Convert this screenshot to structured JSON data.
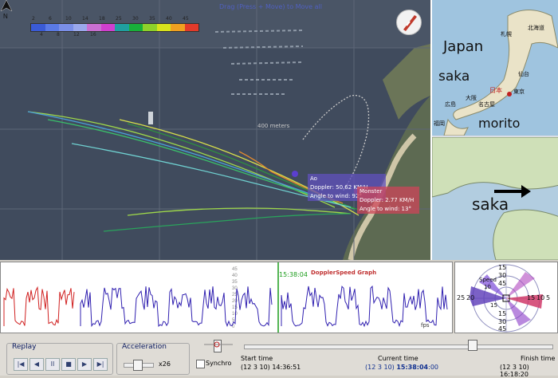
{
  "map": {
    "drag_hint": "Drag (Press + Move) to Move all",
    "meters_label": "400 meters",
    "legend_top_ticks": [
      "2",
      "6",
      "10",
      "14",
      "18",
      "25",
      "30",
      "35",
      "40",
      "45"
    ],
    "legend_bottom_ticks": [
      "4",
      "8",
      "12",
      "16"
    ],
    "legend_colors": [
      "#3a5bd6",
      "#5a7ae6",
      "#7a8fe8",
      "#9aa8ec",
      "#c96fd2",
      "#cf3fcf",
      "#1fa0a0",
      "#18b03a",
      "#8ed12a",
      "#d9e31c",
      "#f0a020",
      "#e23a2a"
    ],
    "info_boxes": [
      {
        "name": "Ao",
        "doppler": "Doppler: 50.62 KM/H",
        "angle": "Angle to wind: 92°"
      },
      {
        "name": "Monster",
        "doppler": "Doppler: 2.77 KM/H",
        "angle": "Angle to wind: 13°"
      }
    ]
  },
  "inset": {
    "japan_label": "Japan",
    "saka_top": "saka",
    "morito_label": "morito",
    "saka_bottom": "saka",
    "city_labels": [
      "札幌",
      "北海道",
      "仙台",
      "日本",
      "東京",
      "広島",
      "大阪",
      "名古屋",
      "福岡"
    ]
  },
  "graph": {
    "title": "DopplerSpeed Graph",
    "current_marker": "15:38:04",
    "fps": "fps",
    "y_ticks": [
      "45",
      "40",
      "35",
      "30",
      "25",
      "20",
      "15",
      "10",
      "5",
      "0"
    ]
  },
  "polar": {
    "labels": [
      "15",
      "30",
      "45",
      "15",
      "30",
      "45",
      "25",
      "20",
      "15",
      "10",
      "5"
    ],
    "speed_label": "Speed",
    "speed_value": "10",
    "center_label": "15"
  },
  "controls": {
    "replay_title": "Replay",
    "acceleration_title": "Acceleration",
    "acceleration_value": "x26",
    "synchro_label": "Synchro",
    "start_label": "Start time",
    "start_value": "(12 3 10) 14:36:51",
    "current_label": "Current time",
    "current_value_prefix": "(12 3 10) ",
    "current_value_time": "15:38:04",
    "current_value_suffix": ":00",
    "finish_label": "Finish time",
    "finish_value": "(12 3 10) 16:18:20",
    "current_progress": 0.74
  }
}
